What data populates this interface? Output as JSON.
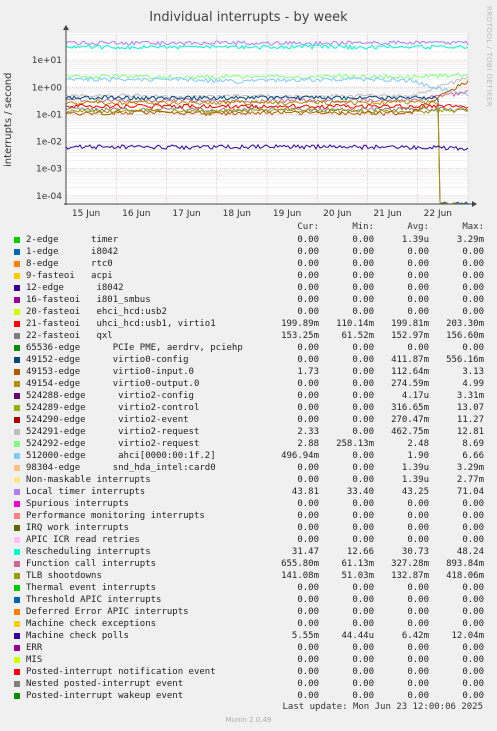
{
  "page": {
    "watermark": "RRDTOOL / TOBI OETIKER",
    "last_update": "Last update: Mon Jun 23 12:00:06 2025",
    "munin_version": "Munin 2.0.49"
  },
  "legend_header": {
    "cur": "Cur:",
    "min": "Min:",
    "avg": "Avg:",
    "max": "Max:"
  },
  "legend": [
    {
      "name": "2-edge      timer",
      "color": "#00cc00",
      "cur": "0.00",
      "min": "0.00",
      "avg": "1.39u",
      "max": "3.29m"
    },
    {
      "name": "1-edge      i8042",
      "color": "#0066b3",
      "cur": "0.00",
      "min": "0.00",
      "avg": "0.00",
      "max": "0.00"
    },
    {
      "name": "8-edge      rtc0",
      "color": "#ff8000",
      "cur": "0.00",
      "min": "0.00",
      "avg": "0.00",
      "max": "0.00"
    },
    {
      "name": "9-fasteoi   acpi",
      "color": "#ffcc00",
      "cur": "0.00",
      "min": "0.00",
      "avg": "0.00",
      "max": "0.00"
    },
    {
      "name": "12-edge      i8042",
      "color": "#330099",
      "cur": "0.00",
      "min": "0.00",
      "avg": "0.00",
      "max": "0.00"
    },
    {
      "name": "16-fasteoi   i801_smbus",
      "color": "#990099",
      "cur": "0.00",
      "min": "0.00",
      "avg": "0.00",
      "max": "0.00"
    },
    {
      "name": "20-fasteoi   ehci_hcd:usb2",
      "color": "#ccff00",
      "cur": "0.00",
      "min": "0.00",
      "avg": "0.00",
      "max": "0.00"
    },
    {
      "name": "21-fasteoi   uhci_hcd:usb1, virtio1",
      "color": "#ff0000",
      "cur": "199.89m",
      "min": "110.14m",
      "avg": "199.81m",
      "max": "203.30m"
    },
    {
      "name": "22-fasteoi   qxl",
      "color": "#808080",
      "cur": "153.25m",
      "min": "61.52m",
      "avg": "152.97m",
      "max": "156.60m"
    },
    {
      "name": "65536-edge      PCIe PME, aerdrv, pciehp",
      "color": "#008f00",
      "cur": "0.00",
      "min": "0.00",
      "avg": "0.00",
      "max": "0.00"
    },
    {
      "name": "49152-edge      virtio0-config",
      "color": "#00487d",
      "cur": "0.00",
      "min": "0.00",
      "avg": "411.87m",
      "max": "556.16m"
    },
    {
      "name": "49153-edge      virtio0-input.0",
      "color": "#b35a00",
      "cur": "1.73",
      "min": "0.00",
      "avg": "112.64m",
      "max": "3.13"
    },
    {
      "name": "49154-edge      virtio0-output.0",
      "color": "#b38f00",
      "cur": "0.00",
      "min": "0.00",
      "avg": "274.59m",
      "max": "4.99"
    },
    {
      "name": "524288-edge      virtio2-config",
      "color": "#6b006b",
      "cur": "0.00",
      "min": "0.00",
      "avg": "4.17u",
      "max": "3.31m"
    },
    {
      "name": "524289-edge      virtio2-control",
      "color": "#8fb300",
      "cur": "0.00",
      "min": "0.00",
      "avg": "316.65m",
      "max": "13.07"
    },
    {
      "name": "524290-edge      virtio2-event",
      "color": "#b30000",
      "cur": "0.00",
      "min": "0.00",
      "avg": "270.47m",
      "max": "11.27"
    },
    {
      "name": "524291-edge      virtio2-request",
      "color": "#bebebe",
      "cur": "2.33",
      "min": "0.00",
      "avg": "462.75m",
      "max": "12.81"
    },
    {
      "name": "524292-edge      virtio2-request",
      "color": "#80ff80",
      "cur": "2.88",
      "min": "258.13m",
      "avg": "2.48",
      "max": "8.69"
    },
    {
      "name": "512000-edge      ahci[0000:00:1f.2]",
      "color": "#80c9ff",
      "cur": "496.94m",
      "min": "0.00",
      "avg": "1.90",
      "max": "6.66"
    },
    {
      "name": "98304-edge      snd_hda_intel:card0",
      "color": "#ffc080",
      "cur": "0.00",
      "min": "0.00",
      "avg": "1.39u",
      "max": "3.29m"
    },
    {
      "name": "Non-maskable interrupts",
      "color": "#ffe680",
      "cur": "0.00",
      "min": "0.00",
      "avg": "1.39u",
      "max": "2.77m"
    },
    {
      "name": "Local timer interrupts",
      "color": "#aa80ff",
      "cur": "43.81",
      "min": "33.40",
      "avg": "43.25",
      "max": "71.04"
    },
    {
      "name": "Spurious interrupts",
      "color": "#ee00cc",
      "cur": "0.00",
      "min": "0.00",
      "avg": "0.00",
      "max": "0.00"
    },
    {
      "name": "Performance monitoring interrupts",
      "color": "#ff8080",
      "cur": "0.00",
      "min": "0.00",
      "avg": "0.00",
      "max": "0.00"
    },
    {
      "name": "IRQ work interrupts",
      "color": "#666600",
      "cur": "0.00",
      "min": "0.00",
      "avg": "0.00",
      "max": "0.00"
    },
    {
      "name": "APIC ICR read retries",
      "color": "#ffbfff",
      "cur": "0.00",
      "min": "0.00",
      "avg": "0.00",
      "max": "0.00"
    },
    {
      "name": "Rescheduling interrupts",
      "color": "#00ffcc",
      "cur": "31.47",
      "min": "12.66",
      "avg": "30.73",
      "max": "48.24"
    },
    {
      "name": "Function call interrupts",
      "color": "#cc6699",
      "cur": "655.80m",
      "min": "61.13m",
      "avg": "327.28m",
      "max": "893.84m"
    },
    {
      "name": "TLB shootdowns",
      "color": "#999900",
      "cur": "141.08m",
      "min": "51.03m",
      "avg": "132.87m",
      "max": "418.06m"
    },
    {
      "name": "Thermal event interrupts",
      "color": "#00cc00",
      "cur": "0.00",
      "min": "0.00",
      "avg": "0.00",
      "max": "0.00"
    },
    {
      "name": "Threshold APIC interrupts",
      "color": "#0066b3",
      "cur": "0.00",
      "min": "0.00",
      "avg": "0.00",
      "max": "0.00"
    },
    {
      "name": "Deferred Error APIC interrupts",
      "color": "#ff8000",
      "cur": "0.00",
      "min": "0.00",
      "avg": "0.00",
      "max": "0.00"
    },
    {
      "name": "Machine check exceptions",
      "color": "#ffcc00",
      "cur": "0.00",
      "min": "0.00",
      "avg": "0.00",
      "max": "0.00"
    },
    {
      "name": "Machine check polls",
      "color": "#330099",
      "cur": "5.55m",
      "min": "44.44u",
      "avg": "6.42m",
      "max": "12.04m"
    },
    {
      "name": "ERR",
      "color": "#990099",
      "cur": "0.00",
      "min": "0.00",
      "avg": "0.00",
      "max": "0.00"
    },
    {
      "name": "MIS",
      "color": "#ccff00",
      "cur": "0.00",
      "min": "0.00",
      "avg": "0.00",
      "max": "0.00"
    },
    {
      "name": "Posted-interrupt notification event",
      "color": "#ff0000",
      "cur": "0.00",
      "min": "0.00",
      "avg": "0.00",
      "max": "0.00"
    },
    {
      "name": "Nested posted-interrupt event",
      "color": "#808080",
      "cur": "0.00",
      "min": "0.00",
      "avg": "0.00",
      "max": "0.00"
    },
    {
      "name": "Posted-interrupt wakeup event",
      "color": "#008f00",
      "cur": "0.00",
      "min": "0.00",
      "avg": "0.00",
      "max": "0.00"
    }
  ],
  "chart_data": {
    "type": "line",
    "title": "Individual interrupts - by week",
    "ylabel": "interrupts / second",
    "xlabel": "",
    "yscale": "log",
    "ylim": [
      5e-05,
      100
    ],
    "xlim": [
      0,
      8
    ],
    "grid": true,
    "x_ticks": [
      {
        "pos": 0.4,
        "label": "15 Jun"
      },
      {
        "pos": 1.4,
        "label": "16 Jun"
      },
      {
        "pos": 2.4,
        "label": "17 Jun"
      },
      {
        "pos": 3.4,
        "label": "18 Jun"
      },
      {
        "pos": 4.4,
        "label": "19 Jun"
      },
      {
        "pos": 5.4,
        "label": "20 Jun"
      },
      {
        "pos": 6.4,
        "label": "21 Jun"
      },
      {
        "pos": 7.4,
        "label": "22 Jun"
      }
    ],
    "y_ticks": [
      {
        "value": 10,
        "label": "1e+01"
      },
      {
        "value": 1,
        "label": "1e+00"
      },
      {
        "value": 0.1,
        "label": "1e-01"
      },
      {
        "value": 0.01,
        "label": "1e-02"
      },
      {
        "value": 0.001,
        "label": "1e-03"
      },
      {
        "value": 0.0001,
        "label": "1e-04"
      }
    ],
    "series": [
      {
        "name": "Local timer interrupts",
        "color": "#aa80ff",
        "values": [
          43,
          43,
          42,
          44,
          43,
          43,
          44,
          43
        ]
      },
      {
        "name": "Rescheduling interrupts",
        "color": "#00ffcc",
        "values": [
          31,
          30,
          31,
          30,
          31,
          30,
          31,
          31
        ]
      },
      {
        "name": "524292-edge      virtio2-request",
        "color": "#80ff80",
        "values": [
          2.4,
          2.6,
          2.3,
          2.5,
          2.4,
          2.6,
          2.5,
          2.9
        ]
      },
      {
        "name": "512000-edge      ahci[0000:00:1f.2]",
        "color": "#80c9ff",
        "values": [
          1.8,
          2.0,
          1.9,
          1.7,
          1.9,
          2.0,
          1.8,
          0.5
        ]
      },
      {
        "name": "524291-edge      virtio2-request",
        "color": "#bebebe",
        "values": [
          0.45,
          0.5,
          0.42,
          0.47,
          0.45,
          0.48,
          0.46,
          2.3
        ]
      },
      {
        "name": "Function call interrupts",
        "color": "#cc6699",
        "values": [
          0.33,
          0.32,
          0.34,
          0.31,
          0.33,
          0.32,
          0.33,
          0.66
        ]
      },
      {
        "name": "49152-edge      virtio0-config",
        "color": "#00487d",
        "values": [
          0.41,
          0.42,
          0.41,
          0.41,
          0.42,
          0.41,
          0.41,
          0.0
        ]
      },
      {
        "name": "49154-edge      virtio0-output.0",
        "color": "#b38f00",
        "values": [
          0.27,
          0.28,
          0.27,
          0.28,
          0.27,
          0.27,
          0.28,
          0.0
        ]
      },
      {
        "name": "21-fasteoi   uhci_hcd:usb1, virtio1",
        "color": "#ff0000",
        "values": [
          0.2,
          0.2,
          0.2,
          0.2,
          0.2,
          0.2,
          0.2,
          0.2
        ]
      },
      {
        "name": "22-fasteoi   qxl",
        "color": "#808080",
        "values": [
          0.153,
          0.153,
          0.153,
          0.153,
          0.153,
          0.153,
          0.153,
          0.153
        ]
      },
      {
        "name": "TLB shootdowns",
        "color": "#999900",
        "values": [
          0.13,
          0.14,
          0.13,
          0.13,
          0.14,
          0.13,
          0.13,
          0.141
        ]
      },
      {
        "name": "49153-edge      virtio0-input.0",
        "color": "#b35a00",
        "values": [
          0.11,
          0.12,
          0.11,
          0.11,
          0.12,
          0.11,
          0.11,
          1.73
        ]
      },
      {
        "name": "Machine check polls",
        "color": "#330099",
        "values": [
          0.0064,
          0.0065,
          0.0063,
          0.0064,
          0.0065,
          0.0064,
          0.0063,
          0.0056
        ]
      }
    ]
  }
}
